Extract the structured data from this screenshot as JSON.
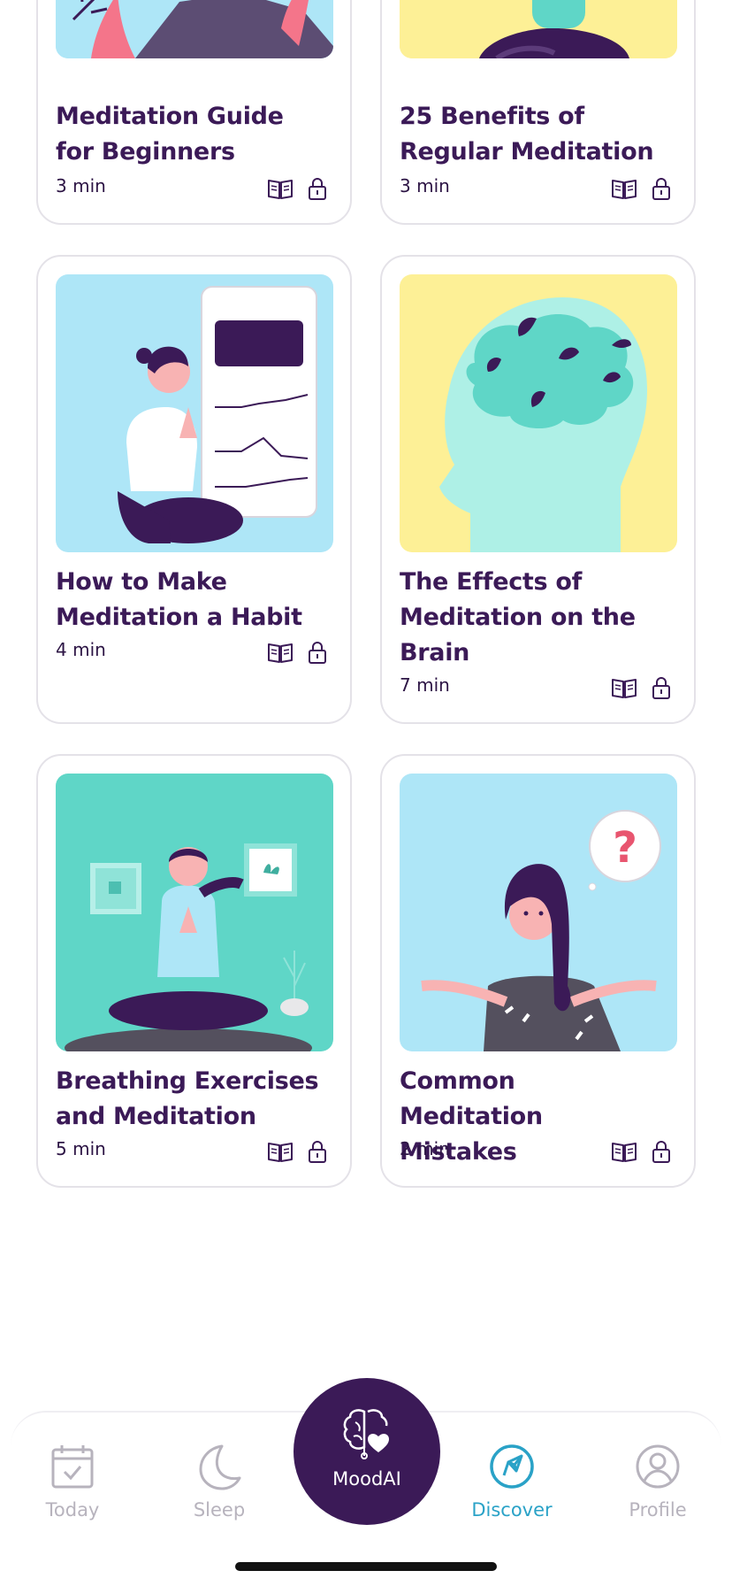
{
  "articles": [
    {
      "title": "Meditation Guide for Beginners",
      "duration": "3 min"
    },
    {
      "title": "25 Benefits of Regular Meditation",
      "duration": "3 min"
    },
    {
      "title": "How to Make Meditation a Habit",
      "duration": "4 min"
    },
    {
      "title": "The Effects of Meditation on the Brain",
      "duration": "7 min"
    },
    {
      "title": "Breathing Exercises and Meditation",
      "duration": "5 min"
    },
    {
      "title": "Common Meditation Mistakes",
      "duration": "2 min"
    }
  ],
  "icons": {
    "read": "open-book-icon",
    "locked": "lock-icon"
  },
  "tabs": {
    "today": "Today",
    "sleep": "Sleep",
    "moodai": "MoodAI",
    "discover": "Discover",
    "profile": "Profile"
  },
  "colors": {
    "primary": "#3b1a57",
    "accent": "#2aa2c7",
    "inactive": "#b7b3bd",
    "card_border": "#e4e2e8",
    "thumb_blue": "#aee6f7",
    "thumb_yellow": "#fdf096",
    "thumb_teal": "#5fd6c7"
  }
}
